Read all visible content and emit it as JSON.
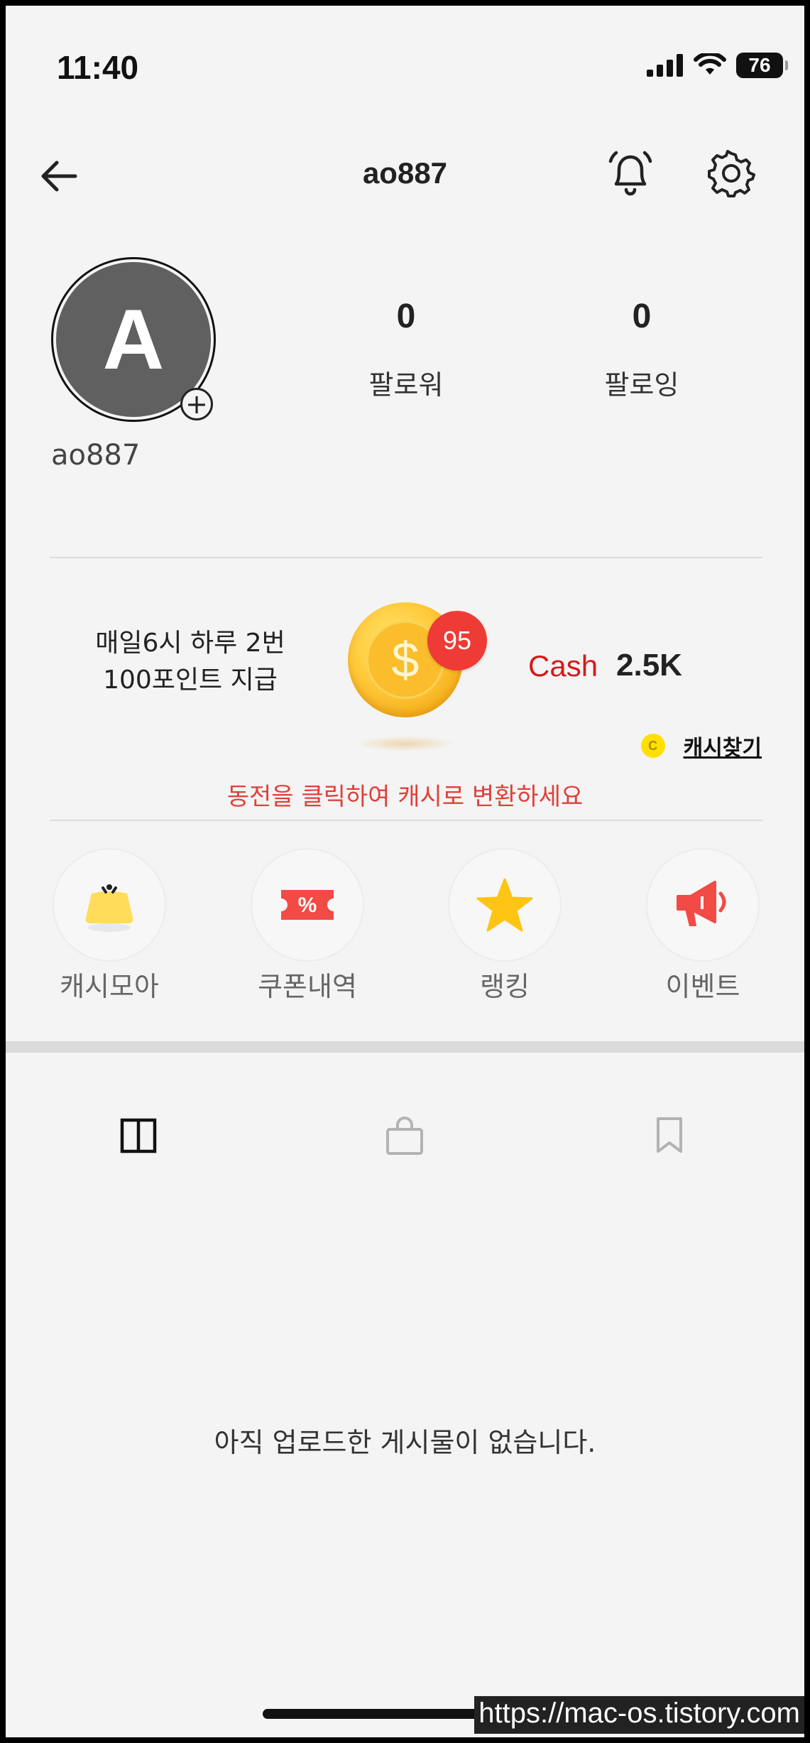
{
  "status_bar": {
    "time": "11:40",
    "battery": "76"
  },
  "header": {
    "title": "ao887"
  },
  "profile": {
    "avatar_letter": "A",
    "username": "ao887",
    "followers": {
      "count": "0",
      "label": "팔로워"
    },
    "following": {
      "count": "0",
      "label": "팔로잉"
    }
  },
  "cash": {
    "promo_line1": "매일6시 하루 2번",
    "promo_line2": "100포인트 지급",
    "coin_symbol": "$",
    "coin_badge": "95",
    "label": "Cash",
    "value": "2.5K",
    "find_coin_letter": "C",
    "find_label": "캐시찾기",
    "convert_hint": "동전을 클릭하여 캐시로 변환하세요"
  },
  "quick_menu": [
    {
      "label": "캐시모아",
      "icon": "wallet-icon"
    },
    {
      "label": "쿠폰내역",
      "icon": "coupon-icon",
      "glyph": "%"
    },
    {
      "label": "랭킹",
      "icon": "star-icon"
    },
    {
      "label": "이벤트",
      "icon": "megaphone-icon"
    }
  ],
  "tabs": [
    {
      "icon": "grid-icon",
      "active": true
    },
    {
      "icon": "shopping-bag-icon",
      "active": false
    },
    {
      "icon": "bookmark-icon",
      "active": false
    }
  ],
  "empty_message": "아직 업로드한 게시물이 없습니다.",
  "watermark": "https://mac-os.tistory.com",
  "colors": {
    "accent_red": "#e0403a",
    "cash_red": "#d61a1a",
    "coin_gold": "#ffc93a",
    "badge_red": "#ef3b36"
  }
}
